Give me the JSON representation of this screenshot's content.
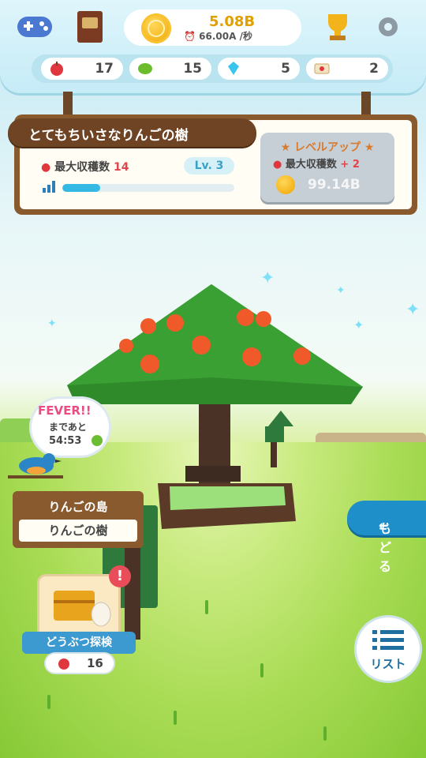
{
  "hud": {
    "coins": "5.08B",
    "rate": "66.00A",
    "rate_unit": "/秒",
    "resources": [
      {
        "icon": "apple-icon",
        "value": "17"
      },
      {
        "icon": "bean-icon",
        "value": "15"
      },
      {
        "icon": "diamond-icon",
        "value": "5"
      },
      {
        "icon": "ticket-icon",
        "value": "2"
      }
    ]
  },
  "tree_panel": {
    "title": "とてもちいさなりんごの樹",
    "max_harvest_label": "最大収穫数",
    "max_harvest_value": "14",
    "level": "Lv. 3",
    "progress": 0.22,
    "level_up": {
      "title": "レベルアップ",
      "bonus_label": "最大収穫数",
      "bonus_value": "+ 2",
      "cost": "99.14B"
    }
  },
  "fever": {
    "title": "FEVER!!",
    "subtitle": "まであと",
    "countdown": "54:53"
  },
  "location": {
    "island": "りんごの島",
    "tree": "りんごの樹"
  },
  "buttons": {
    "back": "もどる",
    "list": "リスト"
  },
  "explore": {
    "label": "どうぶつ探検",
    "count": "16",
    "alert": "!"
  },
  "colors": {
    "accent_blue": "#1e8fc9",
    "coin_gold": "#f0a400",
    "wood": "#8a5a2f"
  }
}
